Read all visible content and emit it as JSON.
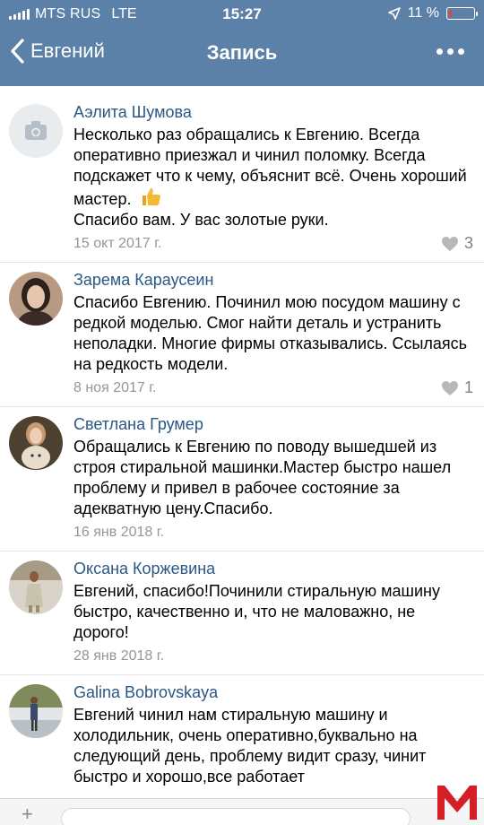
{
  "status_bar": {
    "carrier": "MTS RUS",
    "network": "LTE",
    "time": "15:27",
    "battery_text": "11 %",
    "battery_level": 0.11
  },
  "navbar": {
    "back_label": "Евгений",
    "title": "Запись"
  },
  "comments": [
    {
      "author": "Аэлита Шумова",
      "text": "Несколько раз обращались к Евгению. Всегда оперативно приезжал и чинил поломку.  Всегда подскажет что к чему, объяснит всё.  Очень хороший мастер.",
      "text_tail": "Спасибо вам. У вас золотые руки.",
      "date": "15 окт 2017 г.",
      "likes": "3",
      "avatar": "camera-placeholder"
    },
    {
      "author": "Зарема Караусеин",
      "text": "Спасибо Евгению. Починил мою посудом машину с редкой моделью. Смог найти деталь и устранить неполадки. Многие фирмы отказывались. Ссылаясь на редкость модели.",
      "date": "8 ноя 2017 г.",
      "likes": "1",
      "avatar": "photo"
    },
    {
      "author": "Светлана Грумер",
      "text": "Обращались к Евгению по поводу вышедшей из строя стиральной машинки.Мастер быстро нашел проблему и привел в рабочее состояние за адекватную цену.Спасибо.",
      "date": "16 янв 2018 г.",
      "avatar": "photo"
    },
    {
      "author": "Оксана Коржевина",
      "text": "Евгений, спасибо!Починили стиральную машину быстро, качественно и, что не маловажно, не дорого!",
      "date": "28 янв 2018 г.",
      "avatar": "photo"
    },
    {
      "author": "Galina Bobrovskaya",
      "text": "Евгений чинил нам стиральную машину и холодильник, очень оперативно,буквально на следующий день, проблему видит сразу, чинит быстро и хорошо,все  работает",
      "avatar": "photo"
    }
  ],
  "colors": {
    "header": "#5b81a8",
    "author": "#2a5885",
    "date": "#939699",
    "logo": "#d41f26"
  }
}
